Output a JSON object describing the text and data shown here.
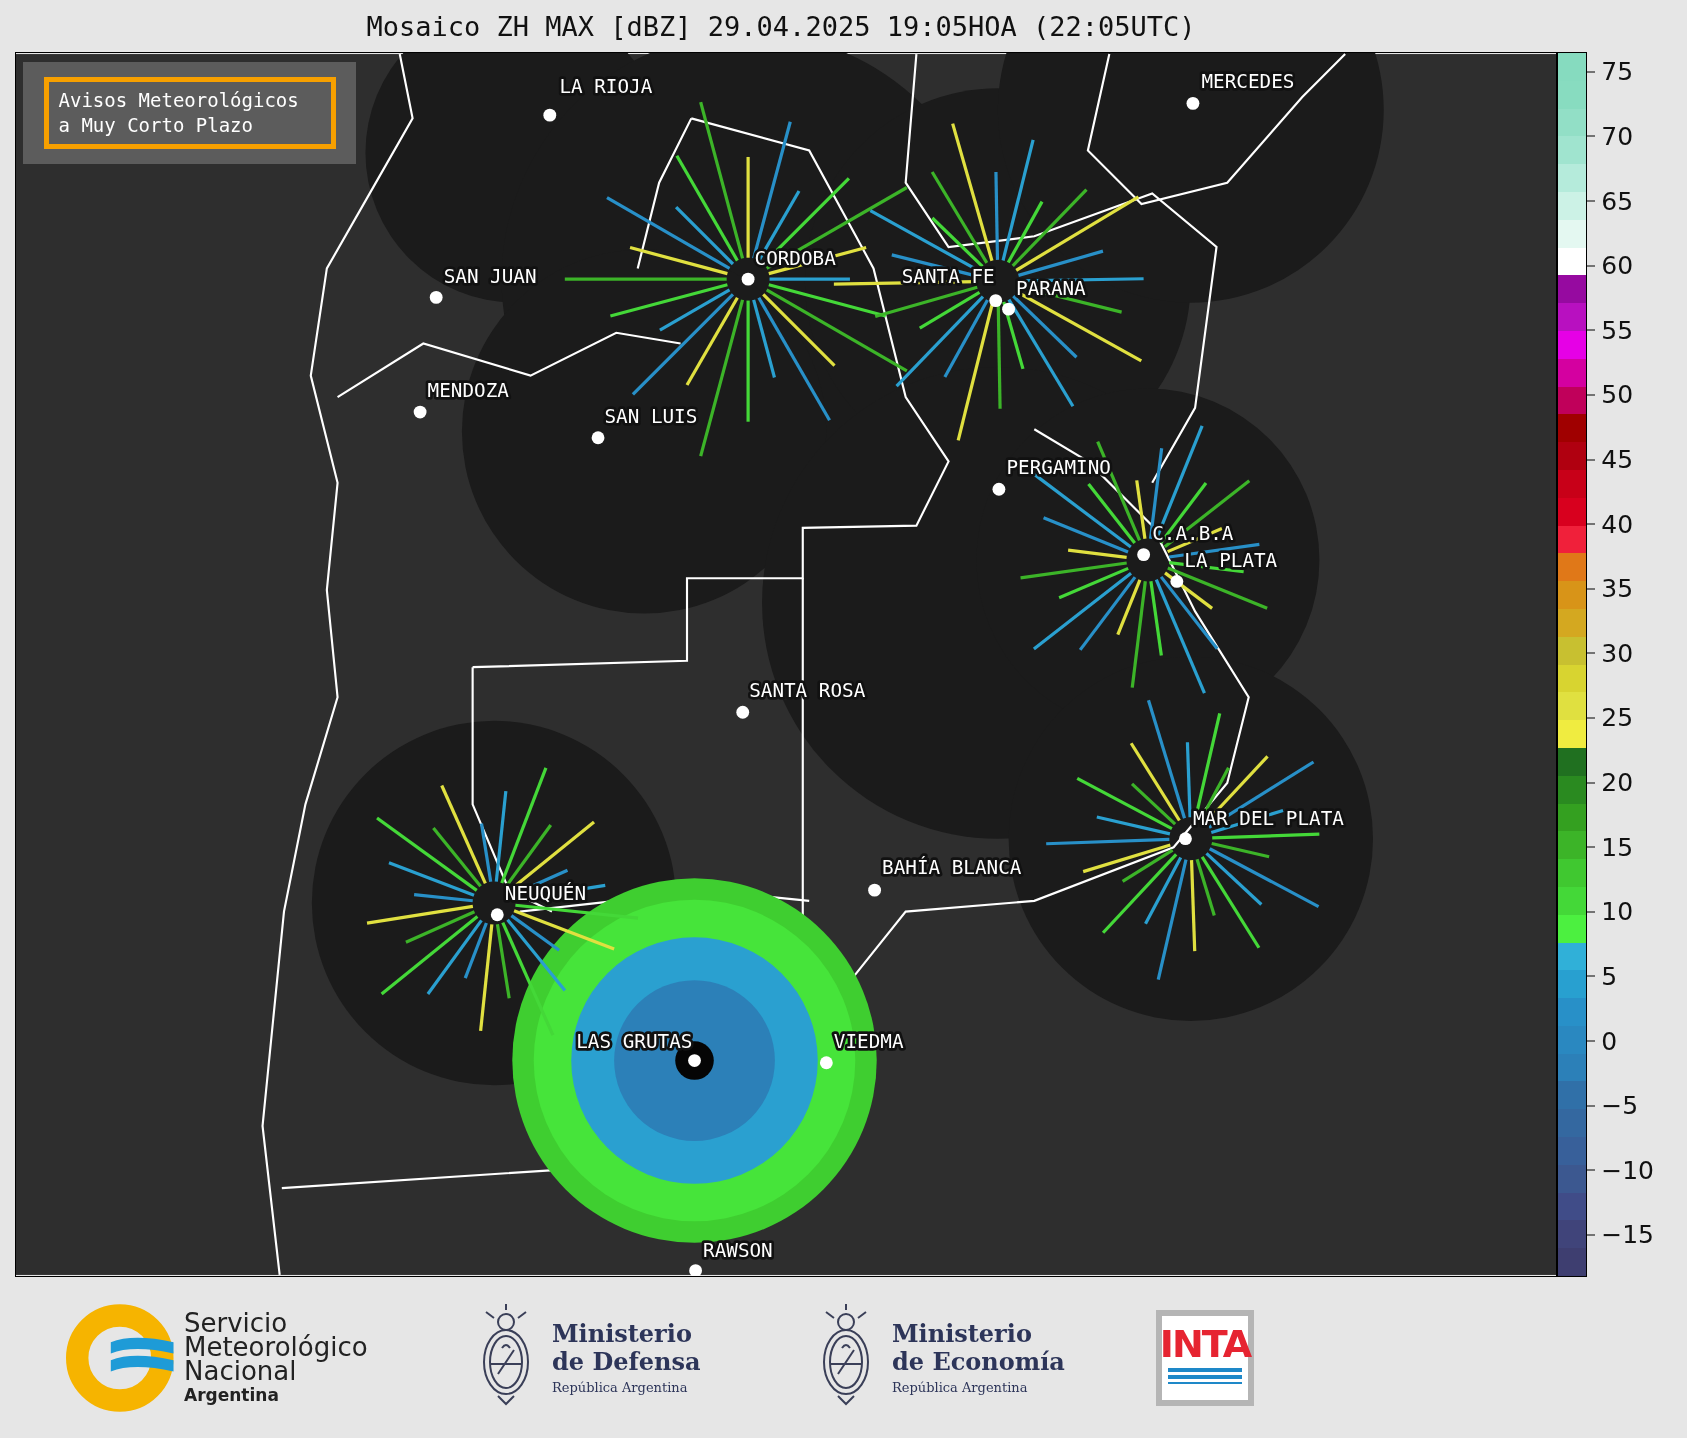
{
  "title": "Mosaico ZH MAX [dBZ] 29.04.2025 19:05HOA (22:05UTC)",
  "notice": "Avisos Meteorológicos a Muy Corto Plazo",
  "cities": [
    {
      "name": "LA RIOJA"
    },
    {
      "name": "MERCEDES"
    },
    {
      "name": "CORDOBA"
    },
    {
      "name": "SAN JUAN"
    },
    {
      "name": "SANTA FE"
    },
    {
      "name": "PARANA"
    },
    {
      "name": "MENDOZA"
    },
    {
      "name": "SAN LUIS"
    },
    {
      "name": "PERGAMINO"
    },
    {
      "name": "C.A.B.A"
    },
    {
      "name": "LA PLATA"
    },
    {
      "name": "SANTA ROSA"
    },
    {
      "name": "MAR DEL PLATA"
    },
    {
      "name": "BAHÍA BLANCA"
    },
    {
      "name": "NEUQUÉN"
    },
    {
      "name": "LAS GRUTAS"
    },
    {
      "name": "VIEDMA"
    },
    {
      "name": "RAWSON"
    }
  ],
  "colorbar": {
    "ticks": [
      "75",
      "70",
      "65",
      "60",
      "55",
      "50",
      "45",
      "40",
      "35",
      "30",
      "25",
      "20",
      "15",
      "10",
      "5",
      "0",
      "−5",
      "−10",
      "−15"
    ],
    "segments": [
      {
        "color": "#86dbbf"
      },
      {
        "color": "#88dcc0"
      },
      {
        "color": "#92dfc6"
      },
      {
        "color": "#a0e4cf"
      },
      {
        "color": "#b5ebdb"
      },
      {
        "color": "#ccf2e6"
      },
      {
        "color": "#e4f8f1"
      },
      {
        "color": "#ffffff"
      },
      {
        "color": "#960aa0"
      },
      {
        "color": "#b810c0"
      },
      {
        "color": "#e600e6"
      },
      {
        "color": "#d400a0"
      },
      {
        "color": "#c0005a"
      },
      {
        "color": "#a00000"
      },
      {
        "color": "#b00010"
      },
      {
        "color": "#c80018"
      },
      {
        "color": "#d8001e"
      },
      {
        "color": "#f0203a"
      },
      {
        "color": "#e07818"
      },
      {
        "color": "#d89418"
      },
      {
        "color": "#d4a820"
      },
      {
        "color": "#c8c030"
      },
      {
        "color": "#d8d430"
      },
      {
        "color": "#e0e040"
      },
      {
        "color": "#f0ec40"
      },
      {
        "color": "#207020"
      },
      {
        "color": "#2a8a20"
      },
      {
        "color": "#34a020"
      },
      {
        "color": "#3cb428"
      },
      {
        "color": "#40c830"
      },
      {
        "color": "#44d838"
      },
      {
        "color": "#4cf040"
      },
      {
        "color": "#30b0d8"
      },
      {
        "color": "#28a0d0"
      },
      {
        "color": "#2890c8"
      },
      {
        "color": "#2a88c0"
      },
      {
        "color": "#2c80b8"
      },
      {
        "color": "#3070a8"
      },
      {
        "color": "#3468a0"
      },
      {
        "color": "#38609a"
      },
      {
        "color": "#3c5890"
      },
      {
        "color": "#404c88"
      },
      {
        "color": "#40447a"
      },
      {
        "color": "#3e3e70"
      }
    ]
  },
  "logos": [
    {
      "kind": "smn",
      "lines": [
        "Servicio",
        "Meteorológico",
        "Nacional"
      ],
      "sub": "Argentina"
    },
    {
      "kind": "ministry",
      "lines": [
        "Ministerio",
        "de Defensa"
      ],
      "sub": "República Argentina"
    },
    {
      "kind": "ministry",
      "lines": [
        "Ministerio",
        "de Economía"
      ],
      "sub": "República Argentina"
    },
    {
      "kind": "inta",
      "text": "INTA"
    }
  ]
}
